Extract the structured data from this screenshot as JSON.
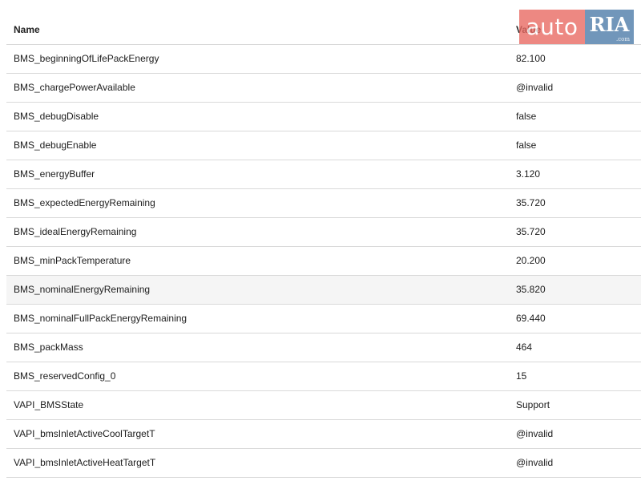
{
  "table": {
    "headers": {
      "name": "Name",
      "value": "Value"
    },
    "rows": [
      {
        "name": "BMS_beginningOfLifePackEnergy",
        "value": "82.100"
      },
      {
        "name": "BMS_chargePowerAvailable",
        "value": "@invalid"
      },
      {
        "name": "BMS_debugDisable",
        "value": "false"
      },
      {
        "name": "BMS_debugEnable",
        "value": "false"
      },
      {
        "name": "BMS_energyBuffer",
        "value": "3.120"
      },
      {
        "name": "BMS_expectedEnergyRemaining",
        "value": "35.720"
      },
      {
        "name": "BMS_idealEnergyRemaining",
        "value": "35.720"
      },
      {
        "name": "BMS_minPackTemperature",
        "value": "20.200"
      },
      {
        "name": "BMS_nominalEnergyRemaining",
        "value": "35.820"
      },
      {
        "name": "BMS_nominalFullPackEnergyRemaining",
        "value": "69.440"
      },
      {
        "name": "BMS_packMass",
        "value": "464"
      },
      {
        "name": "BMS_reservedConfig_0",
        "value": "15"
      },
      {
        "name": "VAPI_BMSState",
        "value": "Support"
      },
      {
        "name": "VAPI_bmsInletActiveCoolTargetT",
        "value": "@invalid"
      },
      {
        "name": "VAPI_bmsInletActiveHeatTargetT",
        "value": "@invalid"
      }
    ]
  },
  "watermark": {
    "left_text": "auto",
    "right_text": "RIA",
    "right_subtext": ".com"
  },
  "colors": {
    "divider": "#d9d9d9",
    "highlight_row": "#f5f5f5",
    "watermark_left": "#e96b64",
    "watermark_right": "#4e7da9"
  }
}
